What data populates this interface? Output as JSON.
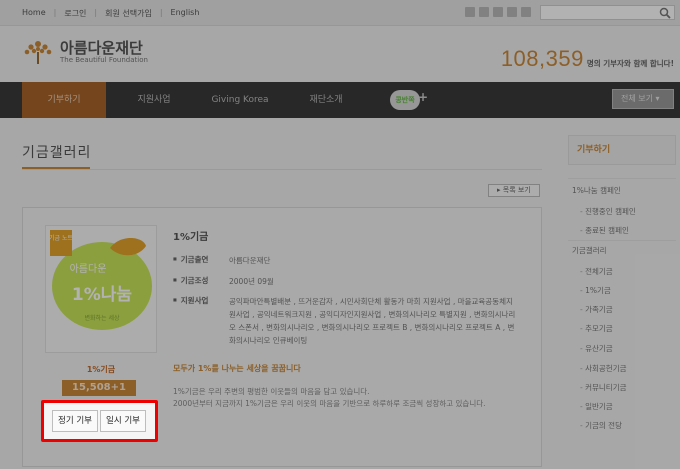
{
  "topnav": {
    "items": [
      "Home",
      "로그인",
      "회원 선택가입",
      "English"
    ]
  },
  "logo": {
    "ko": "아름다운재단",
    "en": "The Beautiful Foundation"
  },
  "counter": {
    "number": "108,359",
    "text": "명의 기부자와 함께 합니다!"
  },
  "mainnav": {
    "items": [
      "기부하기",
      "지원사업",
      "Giving Korea",
      "재단소개"
    ],
    "badge": "콩반쪽",
    "viewall": "전체 보기"
  },
  "page": {
    "title": "기금갤러리",
    "list_button": "목록 보기"
  },
  "fund": {
    "thumb_tag": "기금 노트",
    "thumb_top": "아름다운",
    "thumb_main": "1%나눔",
    "thumb_sub": "변화하는 세상",
    "name": "1%기금",
    "count": "15,508+1",
    "title": "1%기금",
    "info": [
      {
        "key": "기금출연",
        "value": "아름다운재단"
      },
      {
        "key": "기금조성",
        "value": "2000년 09월"
      },
      {
        "key": "지원사업",
        "value": "공익파마안특별배분 , 뜨거운감자 , 시민사회단체 활동가 마희 지원사업 , 마을교육공동체지원사업 , 공익네트워크지원 , 공익디자인지원사업 , 변화의시나리오 특별지원 , 변화의시나리오 스폰서 , 변화의시나리오 , 변화의시나리오 프로젝트 B , 변화의시나리오 프로젝트 A , 변화의시나리오 인큐베이팅"
      }
    ],
    "slogan": "모두가 1%를 나누는 세상을 꿈꿉니다",
    "desc1": "1%기금은 우리 주변의 평범한 이웃들의 마음을 담고 있습니다.",
    "desc2": "2000년부터 지금까지 1%기금은 우리 이웃의 마음을 기반으로 하루하루 조금씩 성장하고 있습니다."
  },
  "buttons": {
    "regular": "정기 기부",
    "onetime": "일시 기부"
  },
  "sidebar": {
    "header": "기부하기",
    "items": [
      {
        "label": "1%나눔 캠페인",
        "sub": false
      },
      {
        "label": "진행중인 캠페인",
        "sub": true
      },
      {
        "label": "종료된 캠페인",
        "sub": true
      },
      {
        "label": "기금갤러리",
        "sub": false
      },
      {
        "label": "전체기금",
        "sub": true
      },
      {
        "label": "1%기금",
        "sub": true
      },
      {
        "label": "가족기금",
        "sub": true
      },
      {
        "label": "추모기금",
        "sub": true
      },
      {
        "label": "유산기금",
        "sub": true
      },
      {
        "label": "사회공헌기금",
        "sub": true
      },
      {
        "label": "커뮤니티기금",
        "sub": true
      },
      {
        "label": "일반기금",
        "sub": true
      },
      {
        "label": "기금의 전당",
        "sub": true
      }
    ]
  },
  "colors": {
    "accent": "#c9883a",
    "highlight": "#e00000",
    "nav_bg": "#3a3a3a"
  }
}
